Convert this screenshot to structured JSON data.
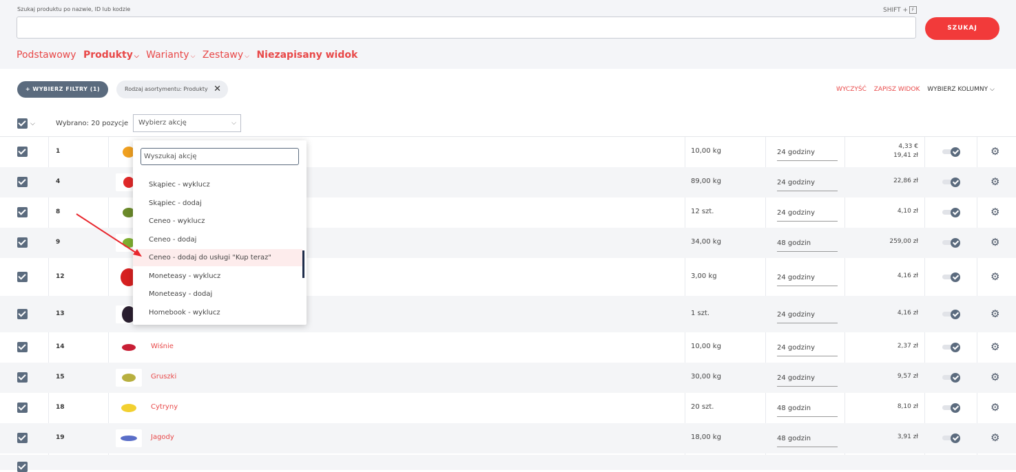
{
  "search": {
    "label": "Szukaj produktu po nazwie, ID lub kodzie",
    "shortcut": "SHIFT +",
    "shortcut_key": "F",
    "value": "",
    "button": "SZUKAJ"
  },
  "tabs": [
    {
      "label": "Podstawowy",
      "bold": false,
      "chevron": false
    },
    {
      "label": "Produkty",
      "bold": true,
      "chevron": true
    },
    {
      "label": "Warianty",
      "bold": false,
      "chevron": true
    },
    {
      "label": "Zestawy",
      "bold": false,
      "chevron": true
    },
    {
      "label": "Niezapisany widok",
      "bold": true,
      "chevron": false
    }
  ],
  "filters": {
    "button": "+ WYBIERZ FILTRY (1)",
    "chip": "Rodzaj asortymentu: Produkty",
    "clear": "WYCZYŚĆ",
    "save_view": "ZAPISZ WIDOK",
    "columns": "WYBIERZ KOLUMNY"
  },
  "selection": {
    "text": "Wybrano: 20 pozycje",
    "action_placeholder": "Wybierz akcję"
  },
  "dropdown": {
    "search_placeholder": "Wyszukaj akcję",
    "items": [
      "Skąpiec - wyklucz",
      "Skąpiec - dodaj",
      "Ceneo - wyklucz",
      "Ceneo - dodaj",
      "Ceneo - dodaj do usługi \"Kup teraz\"",
      "Moneteasy - wyklucz",
      "Moneteasy - dodaj",
      "Homebook - wyklucz"
    ],
    "highlighted_index": 4
  },
  "rows": [
    {
      "id": "1",
      "name": "",
      "weight": "10,00 kg",
      "ship": "24 godziny",
      "price": "4,33 €",
      "price2": "19,41 zł"
    },
    {
      "id": "4",
      "name": "",
      "weight": "89,00 kg",
      "ship": "24 godziny",
      "price": "22,86 zł",
      "price2": ""
    },
    {
      "id": "8",
      "name": "",
      "weight": "12 szt.",
      "ship": "24 godziny",
      "price": "4,10 zł",
      "price2": ""
    },
    {
      "id": "9",
      "name": "",
      "weight": "34,00 kg",
      "ship": "48 godzin",
      "price": "259,00 zł",
      "price2": ""
    },
    {
      "id": "12",
      "name": "",
      "weight": "3,00 kg",
      "ship": "24 godziny",
      "price": "4,16 zł",
      "price2": ""
    },
    {
      "id": "13",
      "name": "",
      "weight": "1 szt.",
      "ship": "24 godziny",
      "price": "4,16 zł",
      "price2": ""
    },
    {
      "id": "14",
      "name": "Wiśnie",
      "weight": "10,00 kg",
      "ship": "24 godziny",
      "price": "2,37 zł",
      "price2": ""
    },
    {
      "id": "15",
      "name": "Gruszki",
      "weight": "30,00 kg",
      "ship": "24 godziny",
      "price": "9,57 zł",
      "price2": ""
    },
    {
      "id": "18",
      "name": "Cytryny",
      "weight": "20 szt.",
      "ship": "48 godzin",
      "price": "8,10 zł",
      "price2": ""
    },
    {
      "id": "19",
      "name": "Jagody",
      "weight": "18,00 kg",
      "ship": "48 godzin",
      "price": "3,91 zł",
      "price2": ""
    }
  ],
  "colors": {
    "accent": "#e84848",
    "button": "#f23a3a",
    "checkbox": "#5b6b7e"
  }
}
